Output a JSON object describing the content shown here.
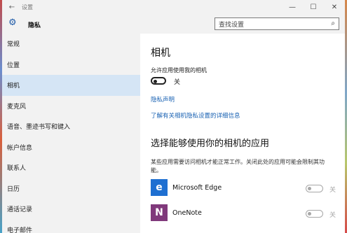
{
  "window": {
    "title": "设置",
    "back_icon": "back-arrow-icon",
    "min": "—",
    "max": "☐",
    "close": "✕"
  },
  "header": {
    "title": "隐私",
    "search_placeholder": "查找设置"
  },
  "sidebar": {
    "items": [
      {
        "label": "常规"
      },
      {
        "label": "位置"
      },
      {
        "label": "相机",
        "active": true
      },
      {
        "label": "麦克风"
      },
      {
        "label": "语音、墨迹书写和键入"
      },
      {
        "label": "帐户信息"
      },
      {
        "label": "联系人"
      },
      {
        "label": "日历"
      },
      {
        "label": "通话记录"
      },
      {
        "label": "电子邮件"
      }
    ]
  },
  "main": {
    "heading": "相机",
    "allow_label": "允许应用使用我的相机",
    "toggle_state": "关",
    "privacy_link": "隐私声明",
    "more_link": "了解有关相机隐私设置的详细信息",
    "apps_heading": "选择能够使用你的相机的应用",
    "apps_desc": "某些应用需要访问相机才能正常工作。关闭此处的应用可能会限制其功能。",
    "apps": [
      {
        "name": "Microsoft Edge",
        "state": "关",
        "icon_color": "#1e6fd1",
        "icon": "edge-icon"
      },
      {
        "name": "OneNote",
        "state": "关",
        "icon_color": "#80397b",
        "icon": "onenote-icon"
      }
    ]
  },
  "colors": {
    "accent": "#1a62b3",
    "active_nav": "#d5e5f5",
    "sidebar_bg": "#f2f2f2"
  }
}
